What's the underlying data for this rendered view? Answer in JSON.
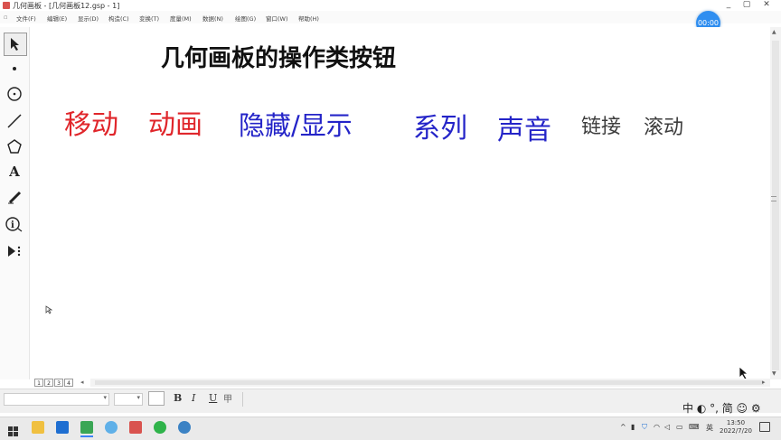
{
  "window": {
    "title": "几何画板 - [几何画板12.gsp - 1]",
    "controls": [
      "_",
      "▢",
      "✕"
    ]
  },
  "menu": [
    "文件(F)",
    "编辑(E)",
    "显示(D)",
    "构造(C)",
    "变换(T)",
    "度量(M)",
    "数据(N)",
    "绘图(G)",
    "窗口(W)",
    "帮助(H)"
  ],
  "timer": "00:00",
  "canvas": {
    "heading": "几何画板的操作类按钮",
    "labels": {
      "move": "移动",
      "animate": "动画",
      "hide_show": "隐藏/显示",
      "series": "系列",
      "sound": "声音",
      "link": "链接",
      "scroll": "滚动"
    }
  },
  "colors": {
    "red": "#e0262b",
    "blue": "#2424c8",
    "gray": "#3c3c3c",
    "timer": "#2f8ef0"
  },
  "pages": [
    "1",
    "2",
    "3",
    "4"
  ],
  "format": {
    "bold": "B",
    "italic": "I",
    "underline": "U"
  },
  "ime": "中 ◐ °, 简 ☺ ⚙",
  "tray": {
    "lang": "英"
  },
  "clock": {
    "time": "13:50",
    "date": "2022/7/20"
  },
  "icons": [
    "arrow-tool-icon",
    "point-tool-icon",
    "compass-tool-icon",
    "line-tool-icon",
    "polygon-tool-icon",
    "text-tool-icon",
    "marker-tool-icon",
    "info-tool-icon",
    "custom-tool-icon"
  ]
}
